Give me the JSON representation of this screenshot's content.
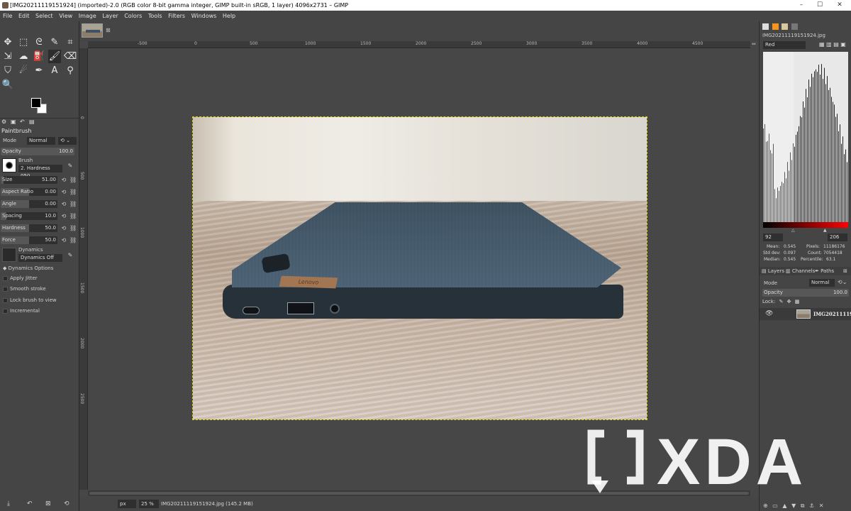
{
  "window": {
    "title": "[IMG20211119151924] (imported)-2.0 (RGB color 8-bit gamma integer, GIMP built-in sRGB, 1 layer) 4096x2731 – GIMP",
    "min": "–",
    "max": "☐",
    "close": "✕"
  },
  "menu": [
    "File",
    "Edit",
    "Select",
    "View",
    "Image",
    "Layer",
    "Colors",
    "Tools",
    "Filters",
    "Windows",
    "Help"
  ],
  "tool_options": {
    "title": "Paintbrush",
    "mode_label": "Mode",
    "mode_value": "Normal",
    "opacity_label": "Opacity",
    "opacity_value": "100.0",
    "opacity_fraction": 1.0,
    "brush_label": "Brush",
    "brush_value": "2. Hardness 050",
    "size_label": "Size",
    "size_value": "51.00",
    "size_fraction": 0.05,
    "aspect_label": "Aspect Ratio",
    "aspect_value": "0.00",
    "aspect_fraction": 0.5,
    "angle_label": "Angle",
    "angle_value": "0.00",
    "angle_fraction": 0.5,
    "spacing_label": "Spacing",
    "spacing_value": "10.0",
    "spacing_fraction": 0.1,
    "hardness_label": "Hardness",
    "hardness_value": "50.0",
    "hardness_fraction": 0.5,
    "force_label": "Force",
    "force_value": "50.0",
    "force_fraction": 0.5,
    "dynamics_label": "Dynamics",
    "dynamics_value": "Dynamics Off",
    "dynamics_options": "Dynamics Options",
    "apply_jitter": "Apply Jitter",
    "smooth_stroke": "Smooth stroke",
    "lock_brush": "Lock brush to view",
    "incremental": "Incremental"
  },
  "rulers": {
    "h": [
      "-500",
      "0",
      "500",
      "1000",
      "1500",
      "2000",
      "2500",
      "3000",
      "3500",
      "4000",
      "4500"
    ],
    "v": [
      "0",
      "500",
      "1000",
      "1500",
      "2000",
      "2500"
    ]
  },
  "image": {
    "logo_text": "Lenovo"
  },
  "status": {
    "unit": "px",
    "zoom": "25 %",
    "file": "IMG20211119151924.jpg (145.2 MB)"
  },
  "histogram": {
    "filename": "IMG20211119151924.jpg",
    "channel": "Red",
    "range_low": "92",
    "range_high": "206",
    "mean_label": "Mean:",
    "mean": "0.545",
    "std_label": "Std dev:",
    "std": "0.097",
    "median_label": "Median:",
    "median": "0.545",
    "pixels_label": "Pixels:",
    "pixels": "11186176",
    "count_label": "Count:",
    "count": "7054418",
    "percentile_label": "Percentile:",
    "percentile": "63.1"
  },
  "layers": {
    "tab_layers": "Layers",
    "tab_channels": "Channels",
    "tab_paths": "Paths",
    "mode_label": "Mode",
    "mode_value": "Normal",
    "opacity_label": "Opacity",
    "opacity_value": "100.0",
    "lock_label": "Lock:",
    "layer_name": "IMG20211119"
  },
  "watermark": {
    "text": "XDA"
  }
}
